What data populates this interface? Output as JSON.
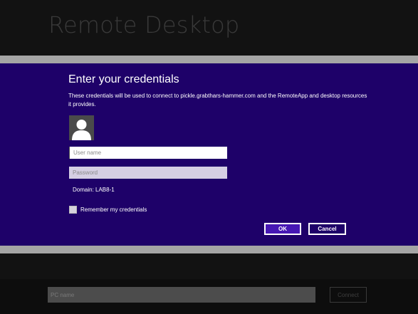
{
  "app": {
    "title": "Remote Desktop"
  },
  "dialog": {
    "title": "Enter your credentials",
    "description": "These credentials will be used to connect to pickle.grabthars-hammer.com and the RemoteApp and desktop resources it provides.",
    "avatar_icon": "user-avatar-icon",
    "username": {
      "value": "",
      "placeholder": "User name"
    },
    "password": {
      "value": "",
      "placeholder": "Password"
    },
    "domain_text": "Domain: LAB8-1",
    "remember": {
      "label": "Remember my credentials",
      "checked": false
    },
    "ok_label": "OK",
    "cancel_label": "Cancel"
  },
  "bottom_bar": {
    "pc_name": {
      "value": "",
      "placeholder": "PC name"
    },
    "connect_label": "Connect"
  },
  "colors": {
    "dialog_background": "#1e0169",
    "band": "#a5a5a5",
    "ok_button": "#4617b4",
    "background": "#121212"
  }
}
